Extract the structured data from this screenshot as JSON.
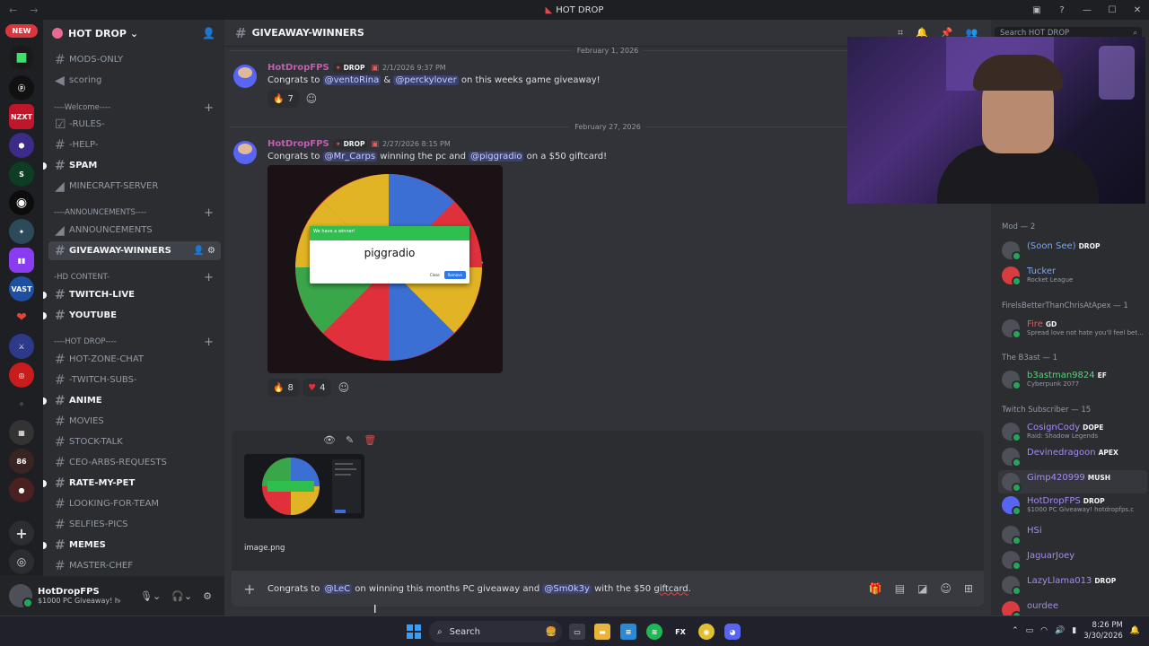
{
  "window": {
    "title": "HOT DROP",
    "title_icon": "discord-red-icon"
  },
  "rail": {
    "new_badge": "NEW"
  },
  "server": {
    "name": "HOT DROP",
    "channels": [
      {
        "label": "MODS-ONLY",
        "type": "text"
      },
      {
        "label": "scoring",
        "type": "voice"
      },
      {
        "label": "----Welcome----",
        "type": "category"
      },
      {
        "label": "-RULES-",
        "type": "rules"
      },
      {
        "label": "-HELP-",
        "type": "text"
      },
      {
        "label": "SPAM",
        "type": "text"
      },
      {
        "label": "MINECRAFT-SERVER",
        "type": "announce"
      },
      {
        "label": "----ANNOUNCEMENTS----",
        "type": "category"
      },
      {
        "label": "ANNOUNCEMENTS",
        "type": "announce"
      },
      {
        "label": "GIVEAWAY-WINNERS",
        "type": "text"
      },
      {
        "label": "-HD CONTENT-",
        "type": "category"
      },
      {
        "label": "TWITCH-LIVE",
        "type": "text"
      },
      {
        "label": "YOUTUBE",
        "type": "text"
      },
      {
        "label": "----HOT DROP----",
        "type": "category"
      },
      {
        "label": "HOT-ZONE-CHAT",
        "type": "text"
      },
      {
        "label": "-TWITCH-SUBS-",
        "type": "text"
      },
      {
        "label": "ANIME",
        "type": "text"
      },
      {
        "label": "MOVIES",
        "type": "text"
      },
      {
        "label": "STOCK-TALK",
        "type": "text"
      },
      {
        "label": "CEO-ARBS-REQUESTS",
        "type": "text"
      },
      {
        "label": "RATE-MY-PET",
        "type": "text"
      },
      {
        "label": "LOOKING-FOR-TEAM",
        "type": "text"
      },
      {
        "label": "SELFIES-PICS",
        "type": "text"
      },
      {
        "label": "MEMES",
        "type": "text"
      },
      {
        "label": "MASTER-CHEF",
        "type": "text"
      }
    ]
  },
  "user": {
    "name": "HotDropFPS",
    "status": "$1000 PC Giveaway! ho"
  },
  "channel": {
    "name": "GIVEAWAY-WINNERS",
    "search_placeholder": "Search HOT DROP"
  },
  "messages": [
    {
      "date": "February 1, 2026",
      "author": "HotDropFPS",
      "tag": "DROP",
      "time": "2/1/2026 9:37 PM",
      "text_parts": [
        "Congrats to ",
        "@ventoRina",
        " & ",
        "@perckylover",
        " on this weeks game giveaway!"
      ],
      "reactions": [
        {
          "emoji": "fire",
          "count": "7"
        }
      ]
    },
    {
      "date": "February 27, 2026",
      "author": "HotDropFPS",
      "tag": "DROP",
      "time": "2/27/2026 8:15 PM",
      "text_parts": [
        "Congrats to ",
        "@Mr_Carps",
        " winning the pc and ",
        "@piggradio",
        " on a $50 giftcard!"
      ],
      "attachment": {
        "dialog_title": "We have a winner!",
        "winner_name": "piggradio",
        "close_label": "Close",
        "remove_label": "Remove"
      },
      "reactions": [
        {
          "emoji": "fire",
          "count": "8"
        },
        {
          "emoji": "heart",
          "count": "4"
        }
      ]
    }
  ],
  "upload": {
    "filename": "image.png"
  },
  "composer": {
    "parts": [
      "Congrats to ",
      "@LeC",
      " on winning this months PC giveaway and ",
      "@Sm0k3y",
      " with the $50 ",
      "giftcard",
      "."
    ]
  },
  "members": {
    "truncated_top": "20 ago",
    "groups": [
      {
        "label": "Mod — 2",
        "members": [
          {
            "name": "(Soon See)",
            "tag": "DROP",
            "status": ""
          },
          {
            "name": "Tucker",
            "tag": "",
            "status": "Rocket League"
          }
        ]
      },
      {
        "label": "FirelsBetterThanChrisAtApex — 1",
        "members": [
          {
            "name": "Fire",
            "tag": "GD",
            "status": "Spread love not hate you'll feel bet..."
          }
        ]
      },
      {
        "label": "The B3ast — 1",
        "members": [
          {
            "name": "b3astman9824",
            "tag": "EF",
            "status": "Cyberpunk 2077"
          }
        ]
      },
      {
        "label": "Twitch Subscriber — 15",
        "members": [
          {
            "name": "CosignCody",
            "tag": "DOPE",
            "status": "Raid: Shadow Legends"
          },
          {
            "name": "Devinedragoon",
            "tag": "APEX",
            "status": ""
          },
          {
            "name": "Gimp420999",
            "tag": "MUSH",
            "status": ""
          },
          {
            "name": "HotDropFPS",
            "tag": "DROP",
            "status": "$1000 PC Giveaway! hotdropfps.c"
          },
          {
            "name": "HSi",
            "tag": "",
            "status": ""
          },
          {
            "name": "JaguarJoey",
            "tag": "",
            "status": ""
          },
          {
            "name": "LazyLlama013",
            "tag": "DROP",
            "status": ""
          },
          {
            "name": "ourdee",
            "tag": "",
            "status": ""
          }
        ]
      }
    ]
  },
  "taskbar": {
    "search_label": "Search",
    "time": "8:26 PM",
    "date": "3/30/2026"
  },
  "colors": {
    "mention_bg": "#3c4270",
    "accent_red": "#ed4245",
    "author": "#c15eb0"
  }
}
